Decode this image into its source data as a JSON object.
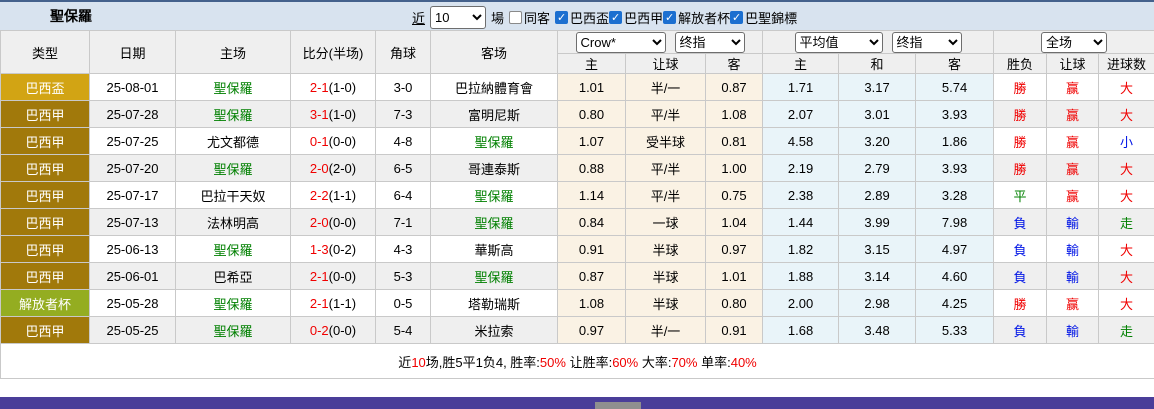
{
  "title": "聖保羅",
  "filter_bar": {
    "near_label": "近",
    "matches_value": "10",
    "games_label": "場",
    "same_away_label": "同客",
    "check_icon": "✓",
    "leagues": [
      {
        "label": "巴西盃",
        "checked": true
      },
      {
        "label": "巴西甲",
        "checked": true
      },
      {
        "label": "解放者杯",
        "checked": true
      },
      {
        "label": "巴聖錦標",
        "checked": true
      }
    ]
  },
  "table": {
    "main_headers": [
      "类型",
      "日期",
      "主场",
      "比分(半场)",
      "角球",
      "客场"
    ],
    "selects": {
      "crow": "Crow*",
      "crow_final": "终指",
      "avg": "平均值",
      "avg_final": "终指",
      "full": "全场"
    },
    "sub_headers": [
      "主",
      "让球",
      "客",
      "主",
      "和",
      "客",
      "胜负",
      "让球",
      "进球数"
    ],
    "rows": [
      {
        "type": "巴西盃",
        "lc": "cup",
        "date": "25-08-01",
        "home": "聖保羅",
        "hh": true,
        "score": "2-1",
        "half": "(1-0)",
        "corner": "3-0",
        "away": "巴拉納體育會",
        "ah": false,
        "crow": [
          "1.01",
          "半/一",
          "0.87"
        ],
        "avg": [
          "1.71",
          "3.17",
          "5.74"
        ],
        "res": [
          {
            "t": "勝",
            "c": "red"
          },
          {
            "t": "赢",
            "c": "red"
          },
          {
            "t": "大",
            "c": "red"
          }
        ]
      },
      {
        "type": "巴西甲",
        "lc": "serie",
        "date": "25-07-28",
        "home": "聖保羅",
        "hh": true,
        "score": "3-1",
        "half": "(1-0)",
        "corner": "7-3",
        "away": "富明尼斯",
        "ah": false,
        "crow": [
          "0.80",
          "平/半",
          "1.08"
        ],
        "avg": [
          "2.07",
          "3.01",
          "3.93"
        ],
        "res": [
          {
            "t": "勝",
            "c": "red"
          },
          {
            "t": "赢",
            "c": "red"
          },
          {
            "t": "大",
            "c": "red"
          }
        ]
      },
      {
        "type": "巴西甲",
        "lc": "serie",
        "date": "25-07-25",
        "home": "尤文都德",
        "hh": false,
        "score": "0-1",
        "half": "(0-0)",
        "corner": "4-8",
        "away": "聖保羅",
        "ah": true,
        "crow": [
          "1.07",
          "受半球",
          "0.81"
        ],
        "avg": [
          "4.58",
          "3.20",
          "1.86"
        ],
        "res": [
          {
            "t": "勝",
            "c": "red"
          },
          {
            "t": "赢",
            "c": "red"
          },
          {
            "t": "小",
            "c": "blue"
          }
        ]
      },
      {
        "type": "巴西甲",
        "lc": "serie",
        "date": "25-07-20",
        "home": "聖保羅",
        "hh": true,
        "score": "2-0",
        "half": "(2-0)",
        "corner": "6-5",
        "away": "哥連泰斯",
        "ah": false,
        "crow": [
          "0.88",
          "平/半",
          "1.00"
        ],
        "avg": [
          "2.19",
          "2.79",
          "3.93"
        ],
        "res": [
          {
            "t": "勝",
            "c": "red"
          },
          {
            "t": "赢",
            "c": "red"
          },
          {
            "t": "大",
            "c": "red"
          }
        ]
      },
      {
        "type": "巴西甲",
        "lc": "serie",
        "date": "25-07-17",
        "home": "巴拉干天奴",
        "hh": false,
        "score": "2-2",
        "half": "(1-1)",
        "corner": "6-4",
        "away": "聖保羅",
        "ah": true,
        "crow": [
          "1.14",
          "平/半",
          "0.75"
        ],
        "avg": [
          "2.38",
          "2.89",
          "3.28"
        ],
        "res": [
          {
            "t": "平",
            "c": "green"
          },
          {
            "t": "赢",
            "c": "red"
          },
          {
            "t": "大",
            "c": "red"
          }
        ]
      },
      {
        "type": "巴西甲",
        "lc": "serie",
        "date": "25-07-13",
        "home": "法林明高",
        "hh": false,
        "score": "2-0",
        "half": "(0-0)",
        "corner": "7-1",
        "away": "聖保羅",
        "ah": true,
        "crow": [
          "0.84",
          "一球",
          "1.04"
        ],
        "avg": [
          "1.44",
          "3.99",
          "7.98"
        ],
        "res": [
          {
            "t": "負",
            "c": "blue"
          },
          {
            "t": "輸",
            "c": "blue"
          },
          {
            "t": "走",
            "c": "green"
          }
        ]
      },
      {
        "type": "巴西甲",
        "lc": "serie",
        "date": "25-06-13",
        "home": "聖保羅",
        "hh": true,
        "score": "1-3",
        "half": "(0-2)",
        "corner": "4-3",
        "away": "華斯高",
        "ah": false,
        "crow": [
          "0.91",
          "半球",
          "0.97"
        ],
        "avg": [
          "1.82",
          "3.15",
          "4.97"
        ],
        "res": [
          {
            "t": "負",
            "c": "blue"
          },
          {
            "t": "輸",
            "c": "blue"
          },
          {
            "t": "大",
            "c": "red"
          }
        ]
      },
      {
        "type": "巴西甲",
        "lc": "serie",
        "date": "25-06-01",
        "home": "巴希亞",
        "hh": false,
        "score": "2-1",
        "half": "(0-0)",
        "corner": "5-3",
        "away": "聖保羅",
        "ah": true,
        "crow": [
          "0.87",
          "半球",
          "1.01"
        ],
        "avg": [
          "1.88",
          "3.14",
          "4.60"
        ],
        "res": [
          {
            "t": "負",
            "c": "blue"
          },
          {
            "t": "輸",
            "c": "blue"
          },
          {
            "t": "大",
            "c": "red"
          }
        ]
      },
      {
        "type": "解放者杯",
        "lc": "libertadores",
        "date": "25-05-28",
        "home": "聖保羅",
        "hh": true,
        "score": "2-1",
        "half": "(1-1)",
        "corner": "0-5",
        "away": "塔勒瑞斯",
        "ah": false,
        "crow": [
          "1.08",
          "半球",
          "0.80"
        ],
        "avg": [
          "2.00",
          "2.98",
          "4.25"
        ],
        "res": [
          {
            "t": "勝",
            "c": "red"
          },
          {
            "t": "赢",
            "c": "red"
          },
          {
            "t": "大",
            "c": "red"
          }
        ]
      },
      {
        "type": "巴西甲",
        "lc": "serie",
        "date": "25-05-25",
        "home": "聖保羅",
        "hh": true,
        "score": "0-2",
        "half": "(0-0)",
        "corner": "5-4",
        "away": "米拉索",
        "ah": false,
        "crow": [
          "0.97",
          "半/一",
          "0.91"
        ],
        "avg": [
          "1.68",
          "3.48",
          "5.33"
        ],
        "res": [
          {
            "t": "負",
            "c": "blue"
          },
          {
            "t": "輸",
            "c": "blue"
          },
          {
            "t": "走",
            "c": "green"
          }
        ]
      }
    ]
  },
  "footer": {
    "segments": [
      {
        "t": "近",
        "red": false
      },
      {
        "t": "10",
        "red": true
      },
      {
        "t": "场,胜5平1负4, 胜率:",
        "red": false
      },
      {
        "t": "50%",
        "red": true
      },
      {
        "t": " 让胜率:",
        "red": false
      },
      {
        "t": "60%",
        "red": true
      },
      {
        "t": " 大率:",
        "red": false
      },
      {
        "t": "70%",
        "red": true
      },
      {
        "t": " 单率:",
        "red": false
      },
      {
        "t": "40%",
        "red": true
      }
    ]
  },
  "colors": {
    "league_cup": "#D2A414",
    "league_serie": "#A1790B",
    "league_libertadores": "#94AD21",
    "accent_red": "#F00000",
    "accent_blue": "#0014E6",
    "accent_green": "#008000",
    "titlebar_bg": "#D8E3EF",
    "purple_bar": "#4A3E99"
  }
}
